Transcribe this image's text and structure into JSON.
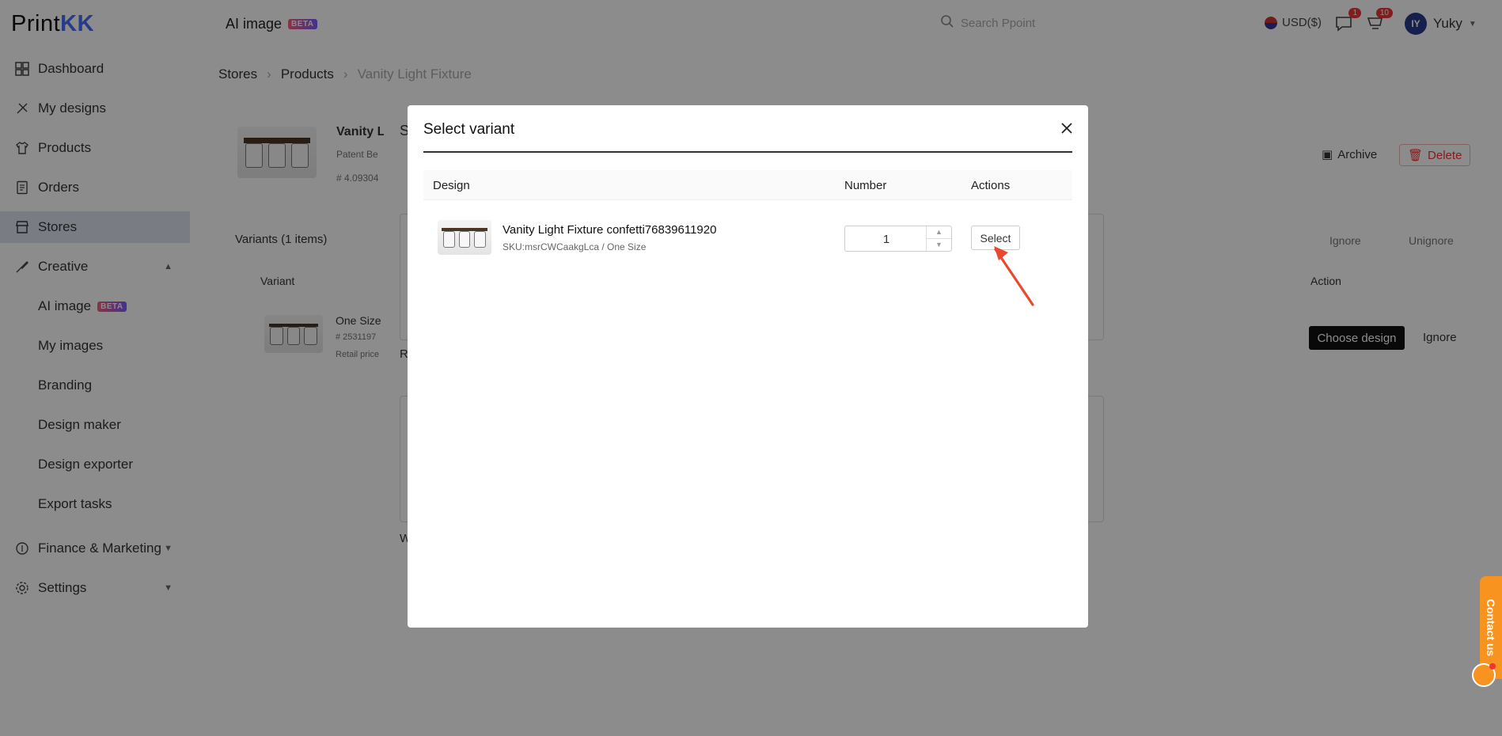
{
  "app": {
    "logo_text": "Print",
    "logo_accent": "KK",
    "top_title": "AI image",
    "beta": "BETA",
    "search_placeholder": "Search Ppoint",
    "currency": "USD($)",
    "messages_badge": "1",
    "notifications_badge": "10",
    "user_initials": "IY",
    "user_name": "Yuky"
  },
  "sidebar": {
    "items": [
      {
        "label": "Dashboard",
        "icon": "grid-icon"
      },
      {
        "label": "My designs",
        "icon": "palette-icon"
      },
      {
        "label": "Products",
        "icon": "shirt-icon"
      },
      {
        "label": "Orders",
        "icon": "document-icon"
      },
      {
        "label": "Stores",
        "icon": "store-icon"
      },
      {
        "label": "Creative",
        "icon": "brush-icon"
      },
      {
        "label": "Finance & Marketing",
        "icon": "coin-icon"
      },
      {
        "label": "Settings",
        "icon": "gear-icon"
      }
    ],
    "creative_sub": [
      "AI image",
      "My images",
      "Branding",
      "Design maker",
      "Design exporter",
      "Export tasks"
    ]
  },
  "breadcrumb": {
    "stores": "Stores",
    "products": "Products",
    "current": "Vanity Light Fixture"
  },
  "background": {
    "product_title": "Vanity L",
    "product_sub": "Patent Be",
    "product_id": "# 4.09304",
    "archive": "Archive",
    "delete": "Delete",
    "variants_title": "Variants (1 items)",
    "ignore": "Ignore",
    "unignore": "Unignore",
    "variant_col": "Variant",
    "action_col": "Action",
    "variant_name": "One Size",
    "variant_id": "# 2531197",
    "variant_price": "Retail price",
    "choose_design": "Choose design",
    "ignore_link": "Ignore",
    "back_modal_letter": "S",
    "back_label_r": "R",
    "back_label_w": "W"
  },
  "modal": {
    "title": "Select variant",
    "columns": {
      "design": "Design",
      "number": "Number",
      "actions": "Actions"
    },
    "rows": [
      {
        "name": "Vanity Light Fixture confetti76839611920",
        "sku": "SKU:msrCWCaakgLca / One Size",
        "number": "1",
        "action": "Select"
      }
    ]
  },
  "contact": "Contact us",
  "colors": {
    "accent": "#4a6cf7",
    "arrow": "#e8492f",
    "contact": "#f7931e",
    "danger": "#e33333"
  }
}
